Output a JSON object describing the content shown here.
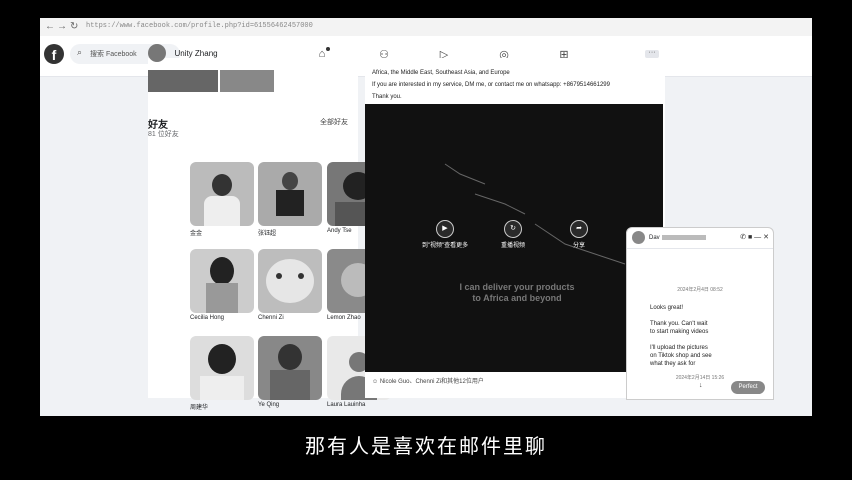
{
  "browser": {
    "url": "https://www.facebook.com/profile.php?id=61556462457000"
  },
  "header": {
    "search_placeholder": "搜索 Facebook",
    "nav_icons": [
      "home-icon",
      "friends-icon",
      "video-icon",
      "marketplace-icon",
      "gaming-icon"
    ]
  },
  "profile": {
    "name": "Unity Zhang"
  },
  "friends": {
    "title": "好友",
    "count": "81 位好友",
    "see_all": "全部好友",
    "list": [
      {
        "name": "金金"
      },
      {
        "name": "张钰超"
      },
      {
        "name": "Andy Tse"
      },
      {
        "name": "Cecilia Hong"
      },
      {
        "name": "Chenni Zi"
      },
      {
        "name": "Lemon Zhao"
      },
      {
        "name": "周建华"
      },
      {
        "name": "Ye Qing"
      },
      {
        "name": "Laura Lauinha"
      }
    ]
  },
  "post": {
    "lines": [
      "Africa, the Middle East, Southeast Asia, and Europe",
      "If you are interested in my service, DM me, or contact me on whatsapp: +8679514661299",
      "Thank you."
    ],
    "video": {
      "buttons": [
        "到\"视频\"查看更多",
        "重播视频",
        "分享"
      ],
      "overlay_text": "I can deliver your products to Africa and beyond"
    },
    "reactions": "Nicole Guo、Chenni Zi和其他12位用户"
  },
  "chat": {
    "name": "Dav",
    "date1": "2024年2月4日 08:52",
    "messages": [
      "Looks great!",
      "Thank you.  Can't wait\nto start making videos",
      "I'll upload the pictures\non Tiktok shop and see\nwhat they ask for"
    ],
    "date2": "2024年2月14日 15:26",
    "bubble": "Perfect"
  },
  "subtitle": "那有人是喜欢在邮件里聊"
}
